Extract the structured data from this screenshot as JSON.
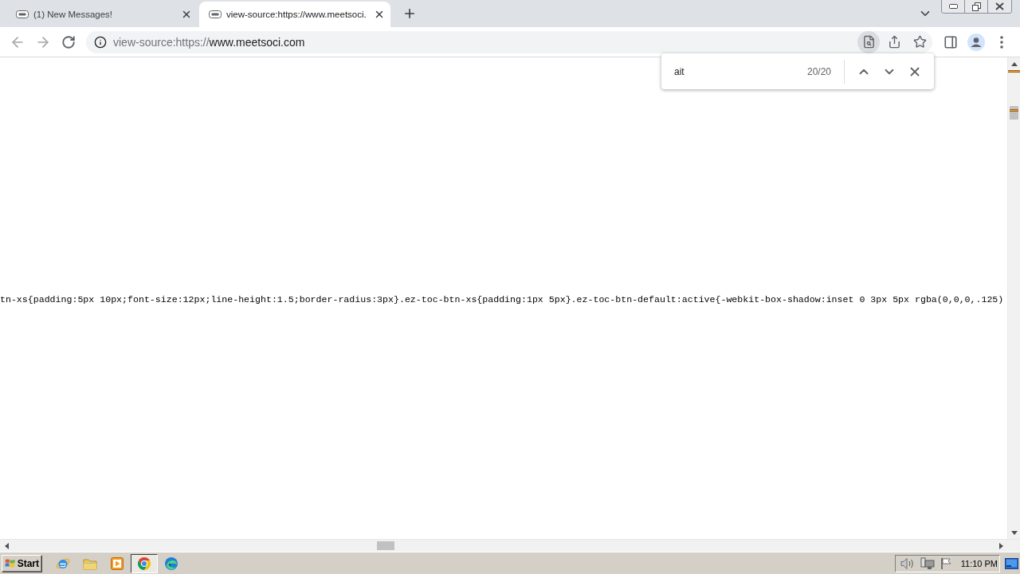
{
  "tabs": [
    {
      "title": "(1) New Messages!",
      "selected": false
    },
    {
      "title": "view-source:https://www.meetsoci.",
      "selected": true
    }
  ],
  "address_bar": {
    "scheme": "view-source:https://",
    "host": "www.meetsoci.com"
  },
  "find_bar": {
    "query": "ait",
    "count": "20/20"
  },
  "source_view": {
    "line": "tn-xs{padding:5px 10px;font-size:12px;line-height:1.5;border-radius:3px}.ez-toc-btn-xs{padding:1px 5px}.ez-toc-btn-default:active{-webkit-box-shadow:inset 0 3px 5px rgba(0,0,0,.125)"
  },
  "taskbar": {
    "start": "Start",
    "apps": [
      {
        "kind": "globe",
        "active": false
      },
      {
        "kind": "folder",
        "active": false
      },
      {
        "kind": "play",
        "active": false
      },
      {
        "kind": "ring",
        "active": true
      },
      {
        "kind": "wave",
        "active": false
      }
    ],
    "clock": "11:10 PM"
  }
}
